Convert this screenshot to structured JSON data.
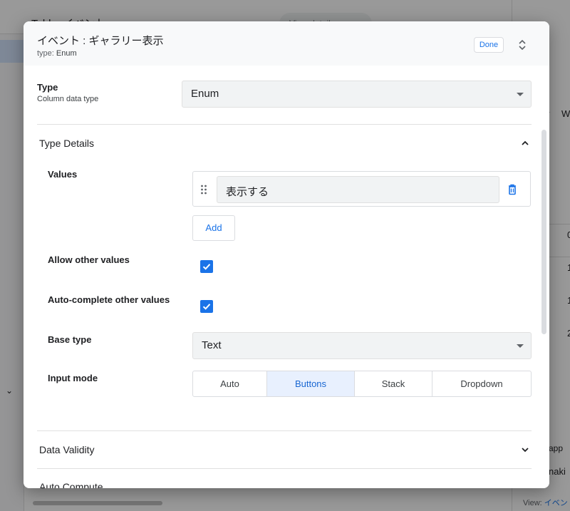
{
  "dialog": {
    "title": "イベント : ギャラリー表示",
    "subtitle_key": "type:",
    "subtitle_value": "Enum",
    "done_label": "Done"
  },
  "type_field": {
    "label": "Type",
    "help": "Column data type",
    "value": "Enum"
  },
  "type_details": {
    "title": "Type Details",
    "values_label": "Values",
    "values": [
      "表示する"
    ],
    "add_label": "Add",
    "allow_other_label": "Allow other values",
    "allow_other_checked": true,
    "autocomplete_label": "Auto-complete other values",
    "autocomplete_checked": true,
    "base_type_label": "Base type",
    "base_type_value": "Text",
    "input_mode_label": "Input mode",
    "input_modes": [
      "Auto",
      "Buttons",
      "Stack",
      "Dropdown"
    ],
    "input_mode_selected": "Buttons"
  },
  "sections": {
    "data_validity": "Data Validity",
    "auto_compute": "Auto Compute"
  },
  "background": {
    "title": "Table: イベント",
    "search_placeholder": "View details",
    "right_texts": [
      "w",
      "W",
      "0",
      "1",
      "1",
      "2",
      "w app",
      "naki"
    ],
    "view_label": "View:",
    "view_link": "イベン"
  },
  "colors": {
    "accent": "#1a73e8",
    "active_segment_bg": "#e8f0fe",
    "field_bg": "#f1f3f4"
  }
}
